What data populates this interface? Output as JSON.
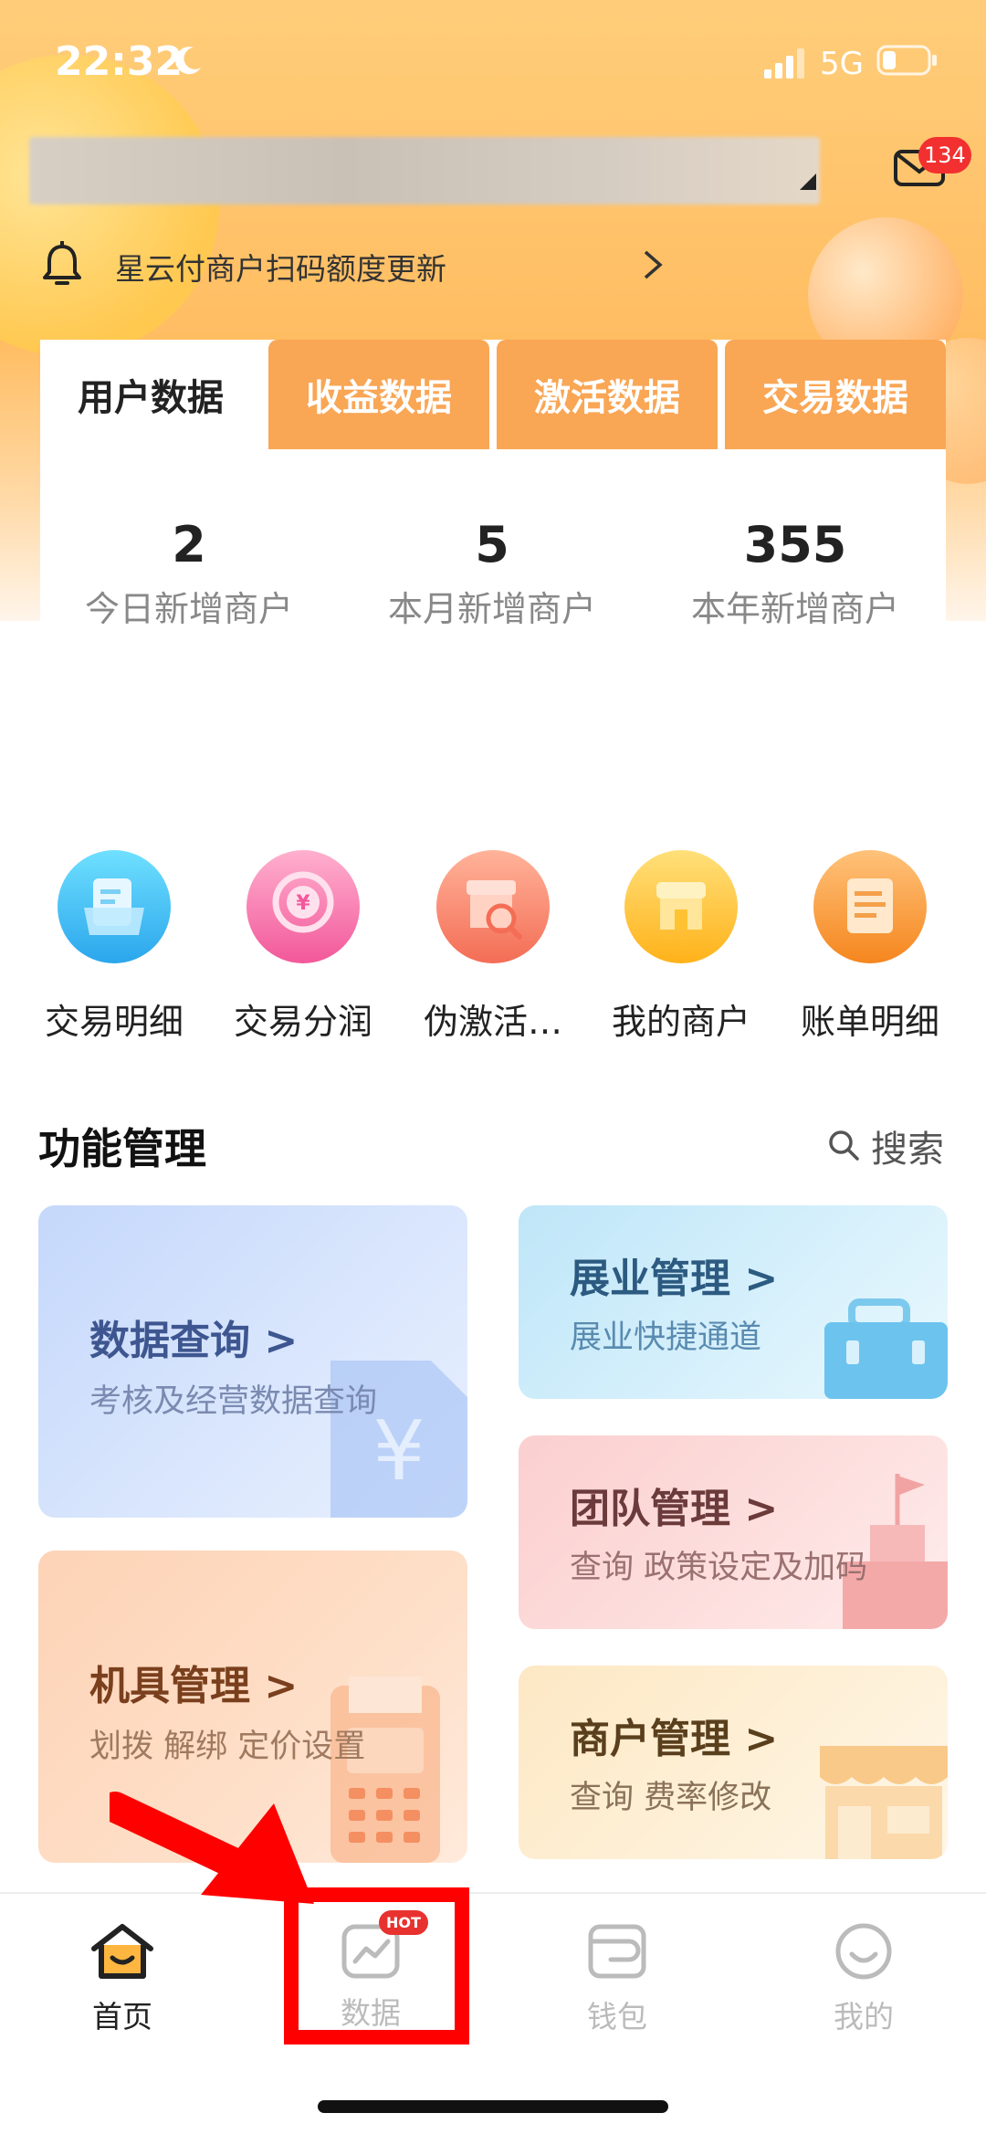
{
  "status_bar": {
    "time": "22:32",
    "network": "5G"
  },
  "header": {
    "mail_badge": "134"
  },
  "notice": {
    "text": "星云付商户扫码额度更新"
  },
  "tabs": [
    {
      "label": "用户数据",
      "active": true
    },
    {
      "label": "收益数据",
      "active": false
    },
    {
      "label": "激活数据",
      "active": false
    },
    {
      "label": "交易数据",
      "active": false
    }
  ],
  "stats": [
    {
      "value": "2",
      "label": "今日新增商户"
    },
    {
      "value": "5",
      "label": "本月新增商户"
    },
    {
      "value": "355",
      "label": "本年新增商户"
    }
  ],
  "shortcuts": [
    {
      "label": "交易明细",
      "icon": "folder-icon"
    },
    {
      "label": "交易分润",
      "icon": "yuan-coin-icon"
    },
    {
      "label": "伪激活…",
      "icon": "store-search-icon"
    },
    {
      "label": "我的商户",
      "icon": "store-icon"
    },
    {
      "label": "账单明细",
      "icon": "bill-icon"
    }
  ],
  "section": {
    "title": "功能管理",
    "search_label": "搜索"
  },
  "function_cards": {
    "data_query": {
      "title": "数据查询 >",
      "subtitle": "考核及经营数据查询"
    },
    "business": {
      "title": "展业管理 >",
      "subtitle": "展业快捷通道"
    },
    "team": {
      "title": "团队管理 >",
      "subtitle": "查询 政策设定及加码"
    },
    "device": {
      "title": "机具管理 >",
      "subtitle": "划拨 解绑 定价设置"
    },
    "merchant": {
      "title": "商户管理 >",
      "subtitle": "查询 费率修改"
    }
  },
  "bottom_nav": [
    {
      "label": "首页",
      "active": true
    },
    {
      "label": "数据",
      "active": false,
      "badge": "HOT"
    },
    {
      "label": "钱包",
      "active": false
    },
    {
      "label": "我的",
      "active": false
    }
  ],
  "colors": {
    "accent_orange": "#f9a655",
    "active_text": "#222222",
    "inactive_nav": "#bbbbbb",
    "annotation_red": "#ff0000"
  }
}
